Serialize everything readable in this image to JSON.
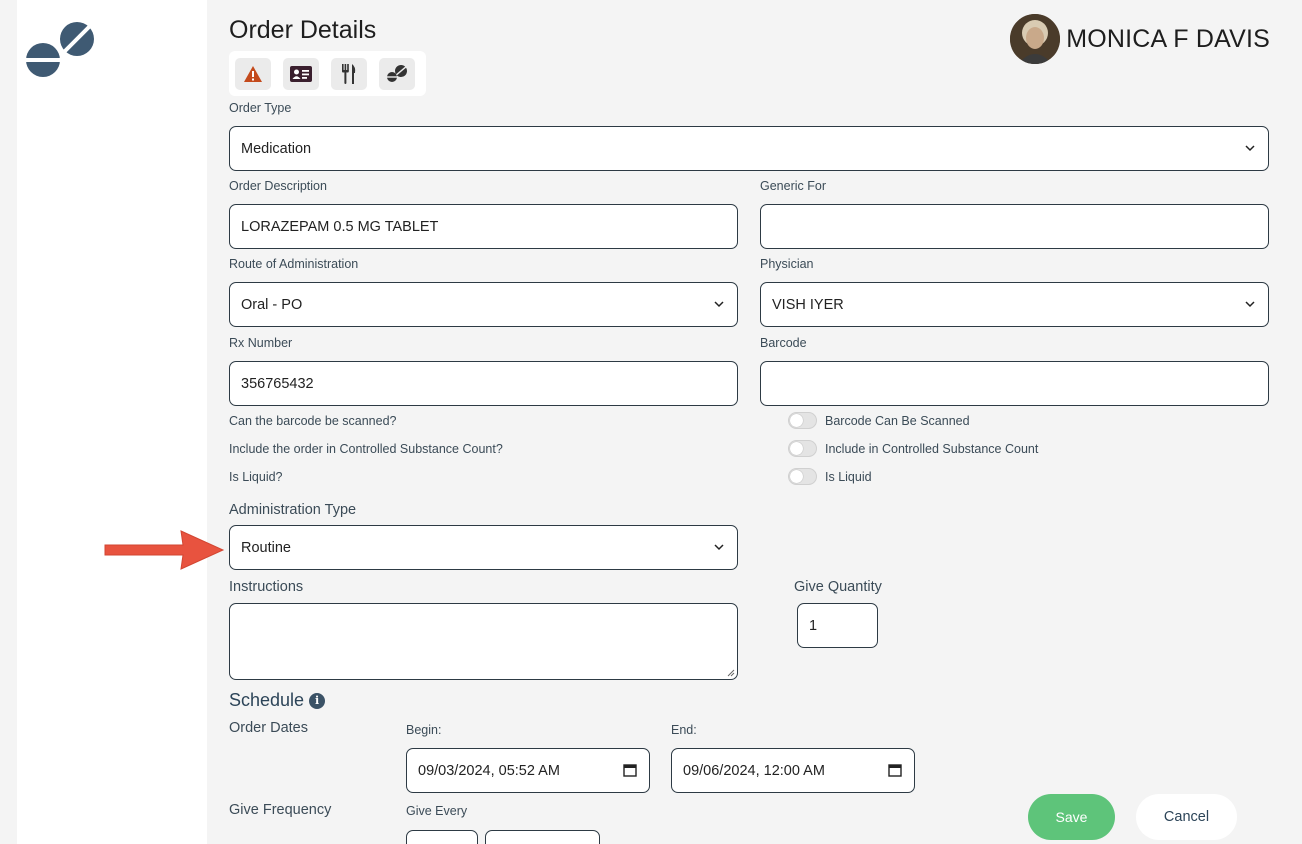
{
  "page": {
    "title": "Order Details"
  },
  "patient": {
    "name": "MONICA F DAVIS"
  },
  "toolbar": {
    "icons": [
      "warning-icon",
      "id-card-icon",
      "utensils-icon",
      "pills-icon"
    ]
  },
  "form": {
    "order_type": {
      "label": "Order Type",
      "value": "Medication"
    },
    "order_description": {
      "label": "Order Description",
      "value": "LORAZEPAM 0.5 MG TABLET"
    },
    "generic_for": {
      "label": "Generic For",
      "value": ""
    },
    "route": {
      "label": "Route of Administration",
      "value": "Oral - PO"
    },
    "physician": {
      "label": "Physician",
      "value": "VISH IYER"
    },
    "rx_number": {
      "label": "Rx Number",
      "value": "356765432"
    },
    "barcode": {
      "label": "Barcode",
      "value": ""
    },
    "q_barcode": "Can the barcode be scanned?",
    "q_controlled": "Include the order in Controlled Substance Count?",
    "q_liquid": "Is Liquid?",
    "t_barcode": "Barcode Can Be Scanned",
    "t_controlled": "Include in Controlled Substance Count",
    "t_liquid": "Is Liquid",
    "administration_type": {
      "label": "Administration Type",
      "value": "Routine"
    },
    "instructions": {
      "label": "Instructions",
      "value": ""
    },
    "give_quantity": {
      "label": "Give Quantity",
      "value": "1"
    }
  },
  "schedule": {
    "title": "Schedule",
    "order_dates_label": "Order Dates",
    "begin_label": "Begin:",
    "begin_value": "09/03/2024, 05:52 AM",
    "end_label": "End:",
    "end_value": "09/06/2024, 12:00 AM",
    "give_frequency_label": "Give Frequency",
    "give_every_label": "Give Every"
  },
  "actions": {
    "save": "Save",
    "cancel": "Cancel"
  },
  "colors": {
    "accent": "#2c4458",
    "save": "#5ec47a",
    "warning": "#c44a1c",
    "arrow": "#e8533f"
  }
}
